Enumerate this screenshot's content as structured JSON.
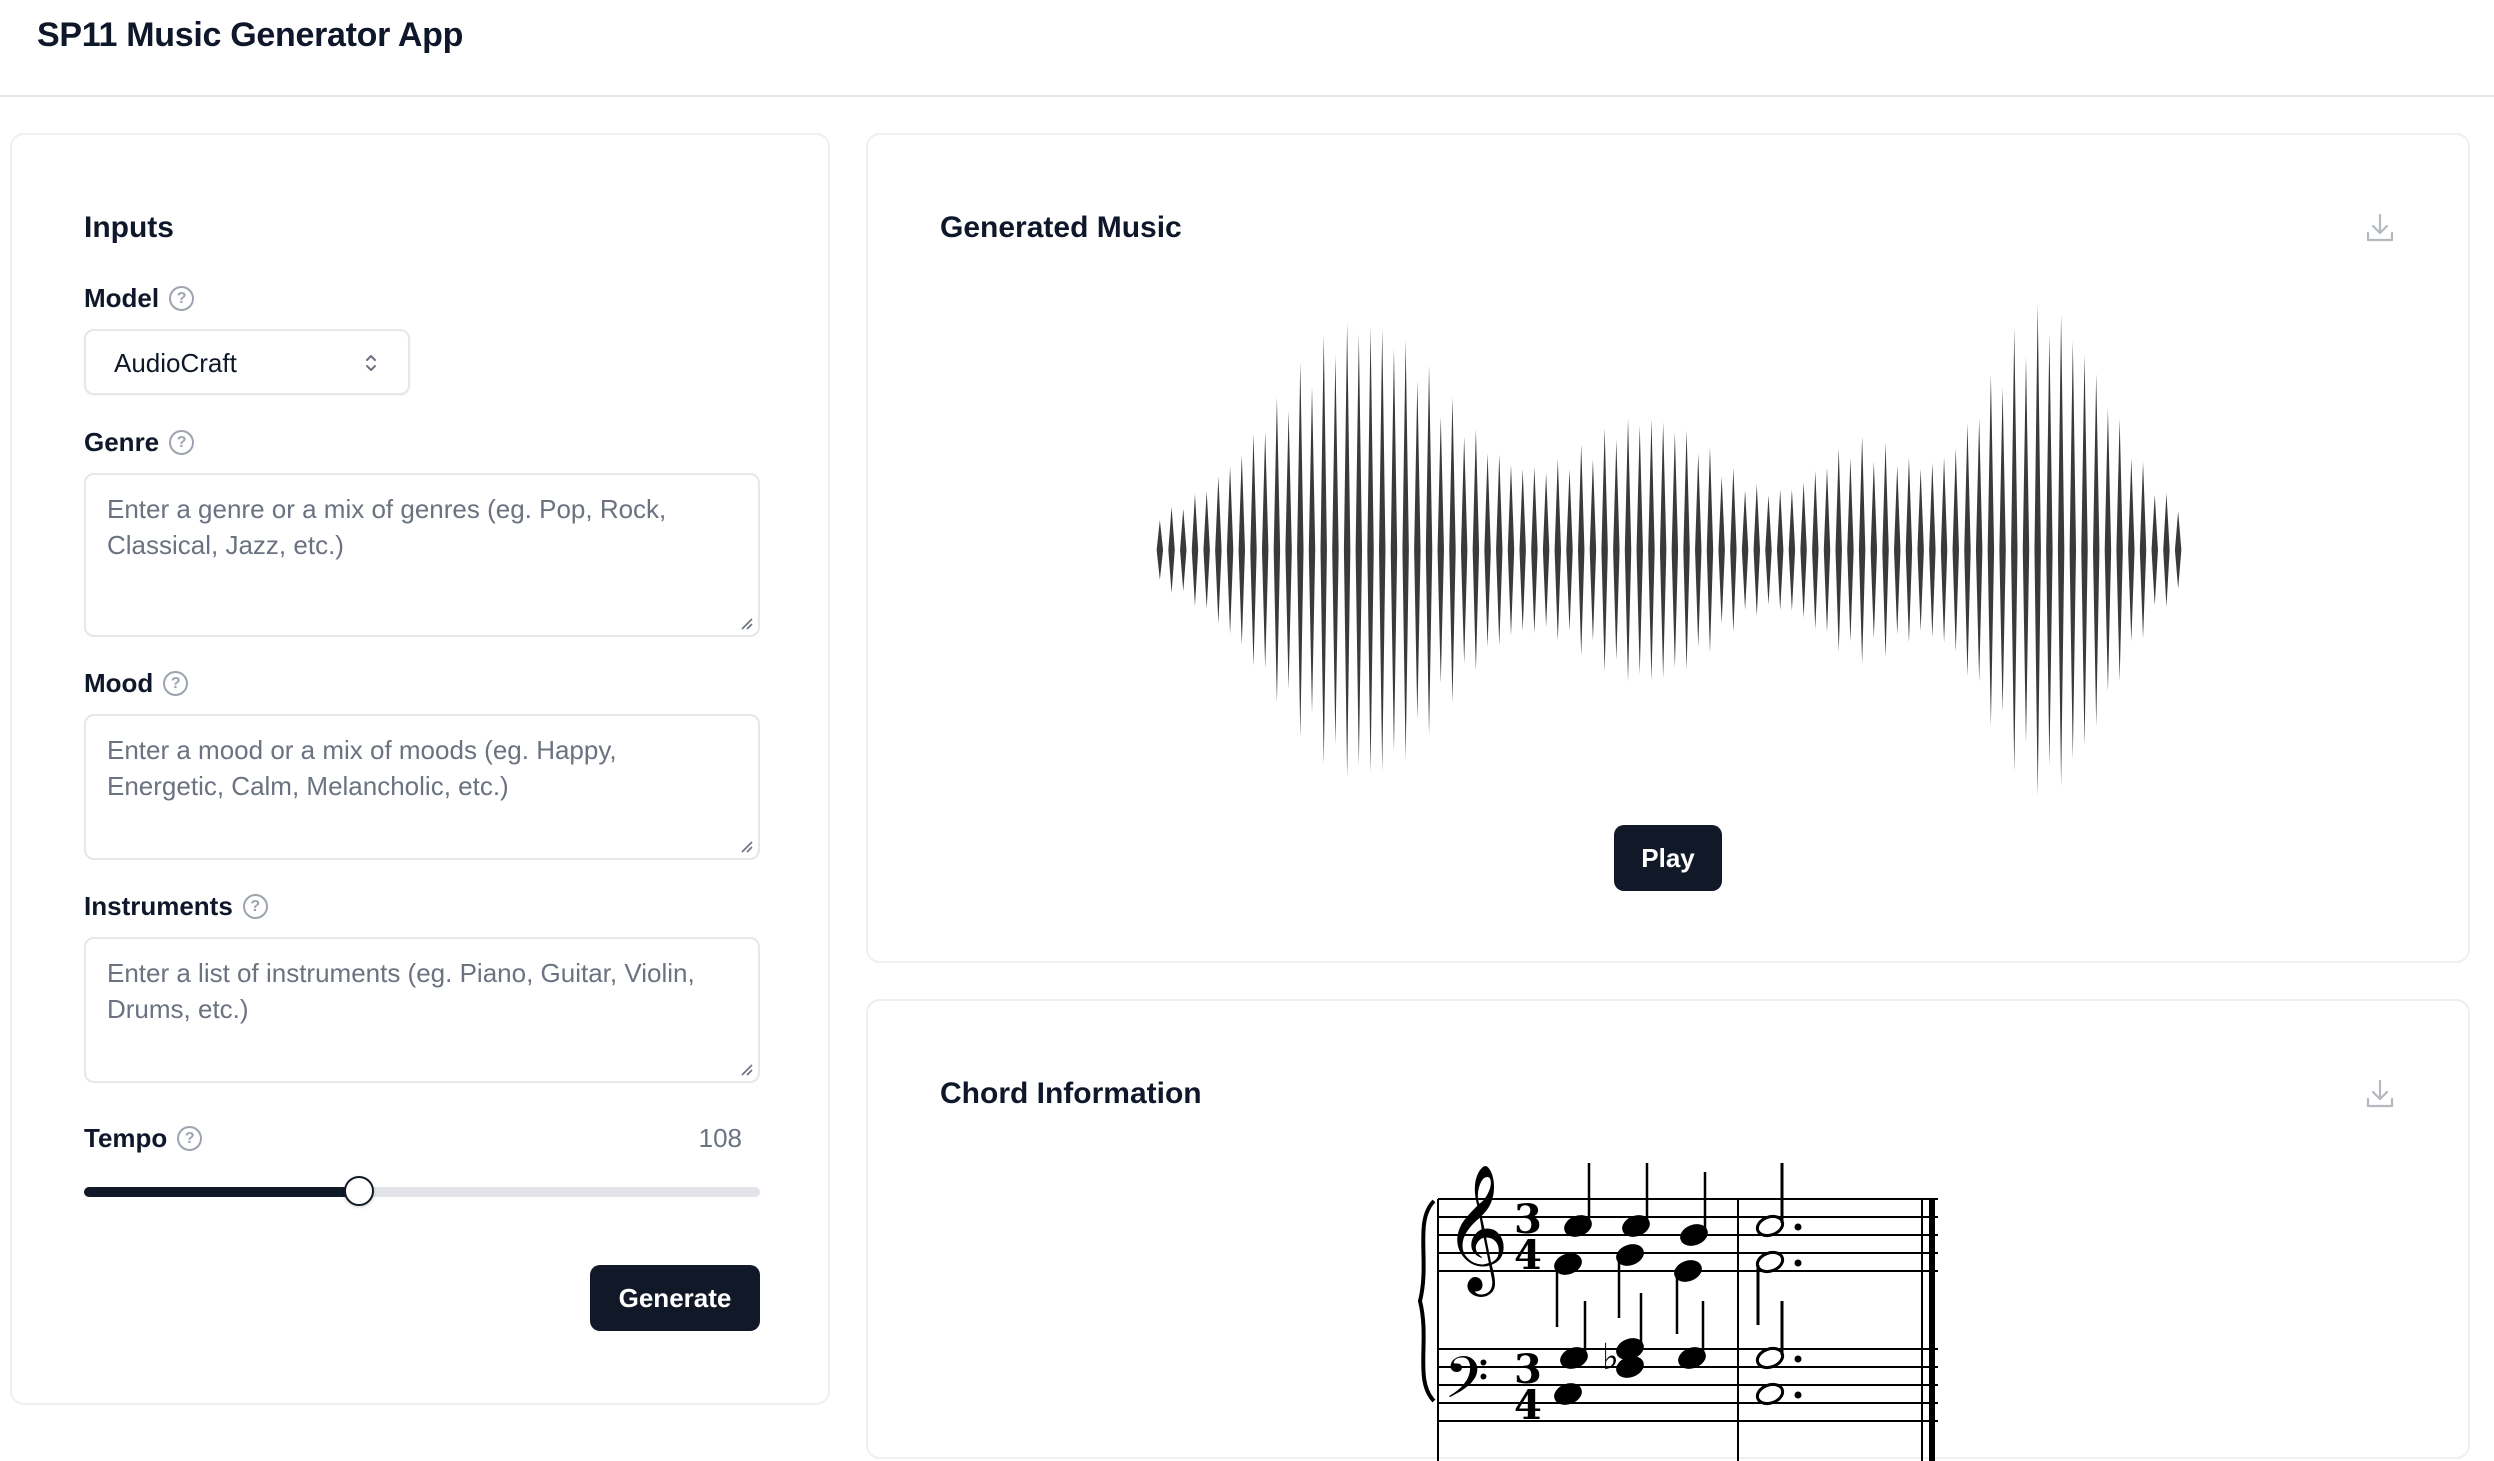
{
  "header": {
    "title": "SP11 Music Generator App"
  },
  "inputs": {
    "title": "Inputs",
    "model": {
      "label": "Model",
      "value": "AudioCraft"
    },
    "genre": {
      "label": "Genre",
      "placeholder": "Enter a genre or a mix of genres (eg. Pop, Rock, Classical, Jazz, etc.)"
    },
    "mood": {
      "label": "Mood",
      "placeholder": "Enter a mood or a mix of moods (eg. Happy, Energetic, Calm, Melancholic, etc.)"
    },
    "instruments": {
      "label": "Instruments",
      "placeholder": "Enter a list of instruments (eg. Piano, Guitar, Violin, Drums, etc.)"
    },
    "tempo": {
      "label": "Tempo",
      "value": "108",
      "min": 0,
      "max": 265
    },
    "generate_label": "Generate",
    "help_glyph": "?"
  },
  "music": {
    "title": "Generated Music",
    "play_label": "Play",
    "icons": [
      "download-icon",
      "waveform-graphic"
    ]
  },
  "chords": {
    "title": "Chord Information",
    "icons": [
      "download-icon",
      "music-score"
    ],
    "score_time_signature": "3/4"
  },
  "colors": {
    "primary_dark": "#111827",
    "border": "#e5e7eb",
    "placeholder": "#6b7280",
    "waveform": "#3a3a3a"
  }
}
